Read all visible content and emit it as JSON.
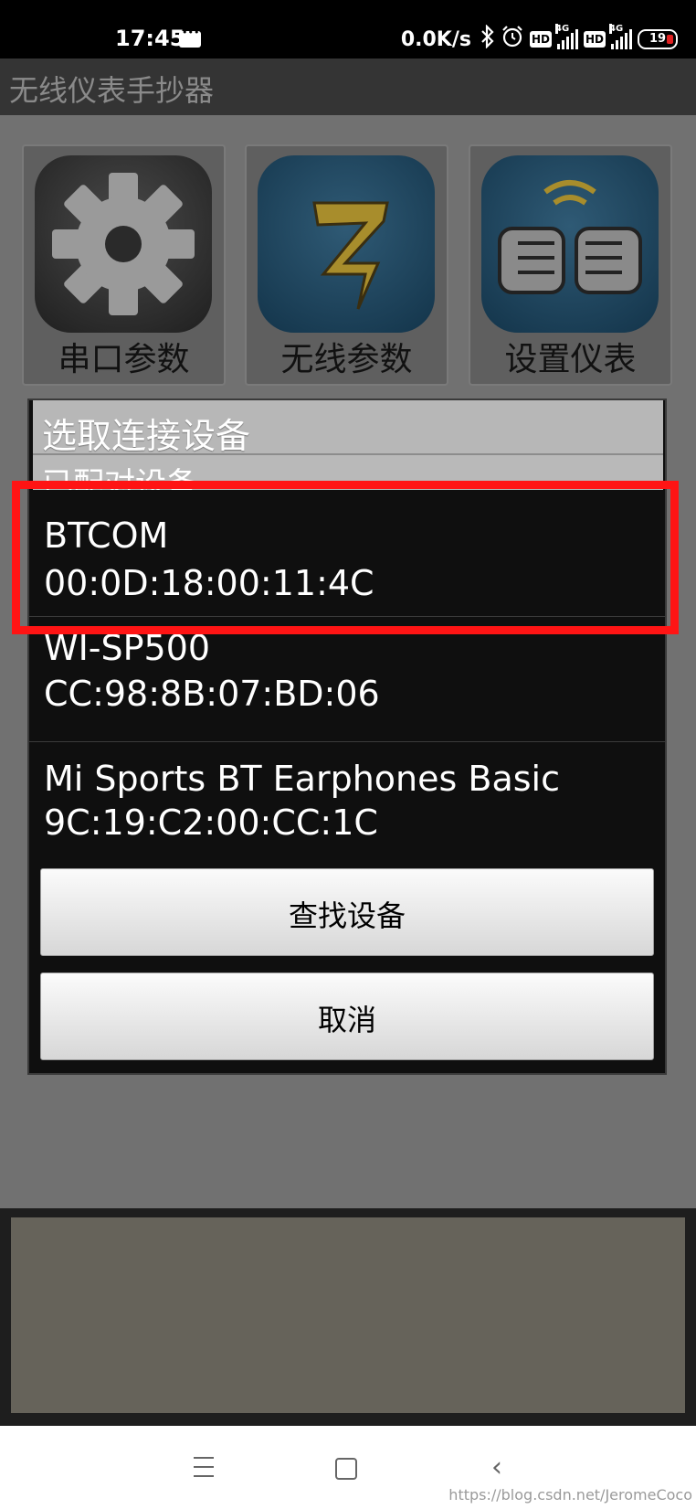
{
  "status_bar": {
    "time": "17:45",
    "network_speed": "0.0K/s",
    "hd_label": "HD",
    "network_type": "4G",
    "battery": "19"
  },
  "app": {
    "title": "无线仪表手抄器",
    "tiles": [
      {
        "label": "串口参数",
        "icon": "gear-icon"
      },
      {
        "label": "无线参数",
        "icon": "lightning-icon"
      },
      {
        "label": "设置仪表",
        "icon": "hands-icon"
      }
    ]
  },
  "dialog": {
    "title": "选取连接设备",
    "section_header": "已配对设备",
    "devices": [
      {
        "name": "BTCOM",
        "address": "00:0D:18:00:11:4C"
      },
      {
        "name": "WI-SP500",
        "address": "CC:98:8B:07:BD:06"
      },
      {
        "name": "Mi Sports BT Earphones Basic",
        "address": "9C:19:C2:00:CC:1C"
      }
    ],
    "find_button": "查找设备",
    "cancel_button": "取消"
  },
  "watermark": "https://blog.csdn.net/JeromeCoco",
  "colors": {
    "highlight": "#ff1414",
    "dialog_background": "#0f0f0f",
    "title_bar": "#b7b7b7"
  }
}
